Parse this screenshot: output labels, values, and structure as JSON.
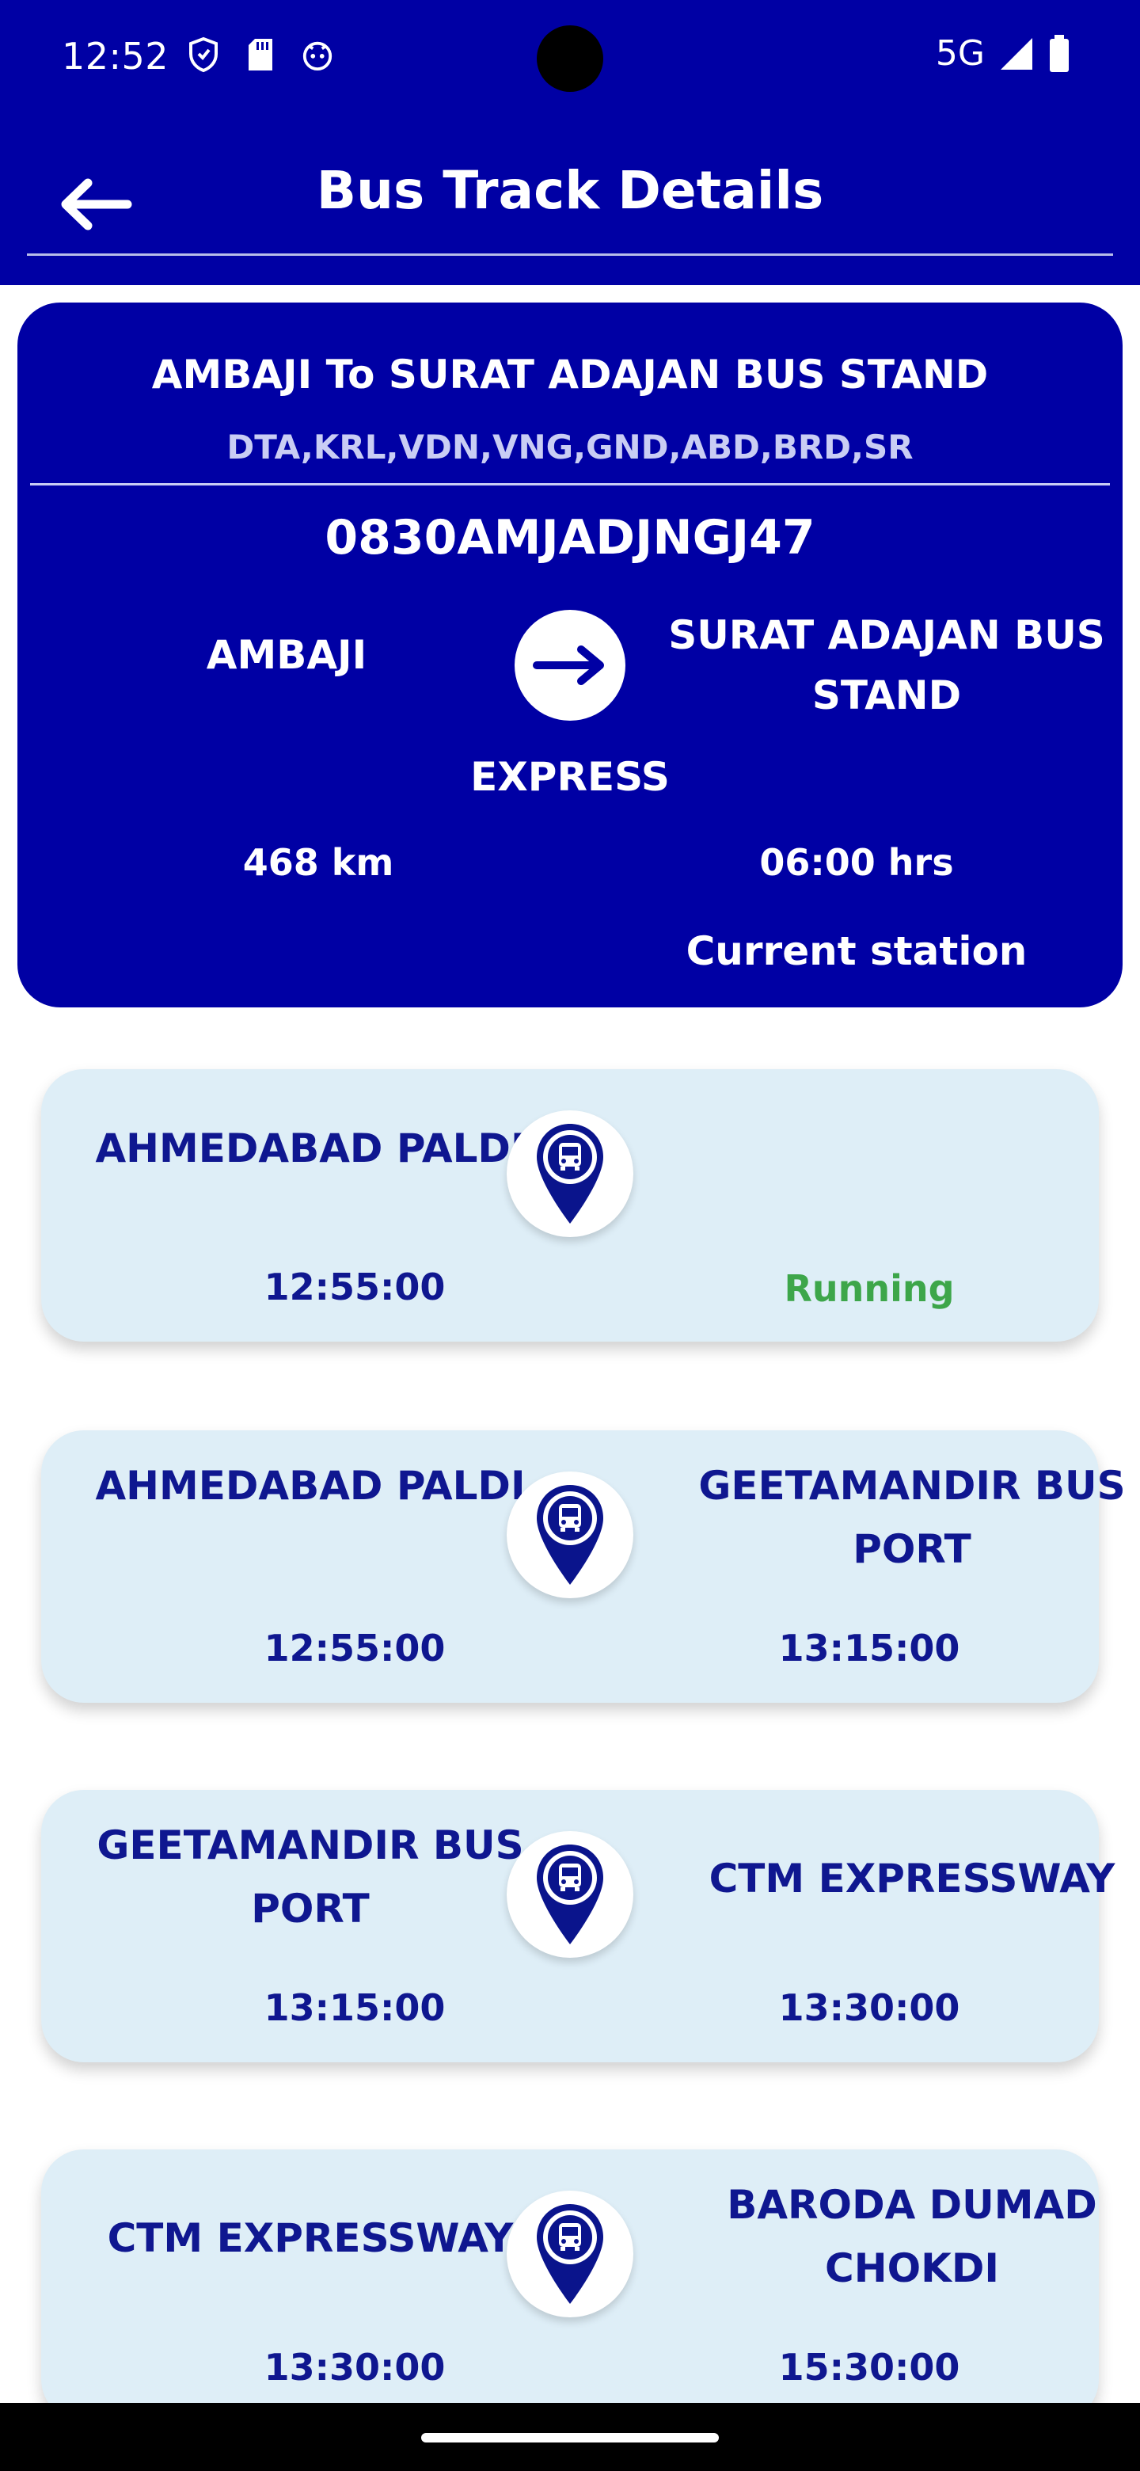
{
  "status_bar": {
    "time": "12:52",
    "network": "5G"
  },
  "app_bar": {
    "title": "Bus Track Details"
  },
  "route": {
    "title": "AMBAJI To SURAT ADAJAN BUS STAND",
    "via": "DTA,KRL,VDN,VNG,GND,ABD,BRD,SR",
    "code": "0830AMJADJNGJ47",
    "from": "AMBAJI",
    "to": "SURAT ADAJAN BUS STAND",
    "service_type": "EXPRESS",
    "distance": "468 km",
    "duration": "06:00 hrs",
    "current_station_label": "Current station"
  },
  "segments": [
    {
      "from": "AHMEDABAD PALDI",
      "to": "",
      "from_time": "12:55:00",
      "to_time": "",
      "status": "Running"
    },
    {
      "from": "AHMEDABAD PALDI",
      "to": "GEETAMANDIR BUS PORT",
      "from_time": "12:55:00",
      "to_time": "13:15:00",
      "status": ""
    },
    {
      "from": "GEETAMANDIR BUS PORT",
      "to": "CTM EXPRESSWAY",
      "from_time": "13:15:00",
      "to_time": "13:30:00",
      "status": ""
    },
    {
      "from": "CTM EXPRESSWAY",
      "to": "BARODA DUMAD CHOKDI",
      "from_time": "13:30:00",
      "to_time": "15:30:00",
      "status": ""
    }
  ],
  "colors": {
    "primary": "#0000a4",
    "card_bg": "#deeef7",
    "text_dark": "#0f1790",
    "running": "#3da64a"
  }
}
